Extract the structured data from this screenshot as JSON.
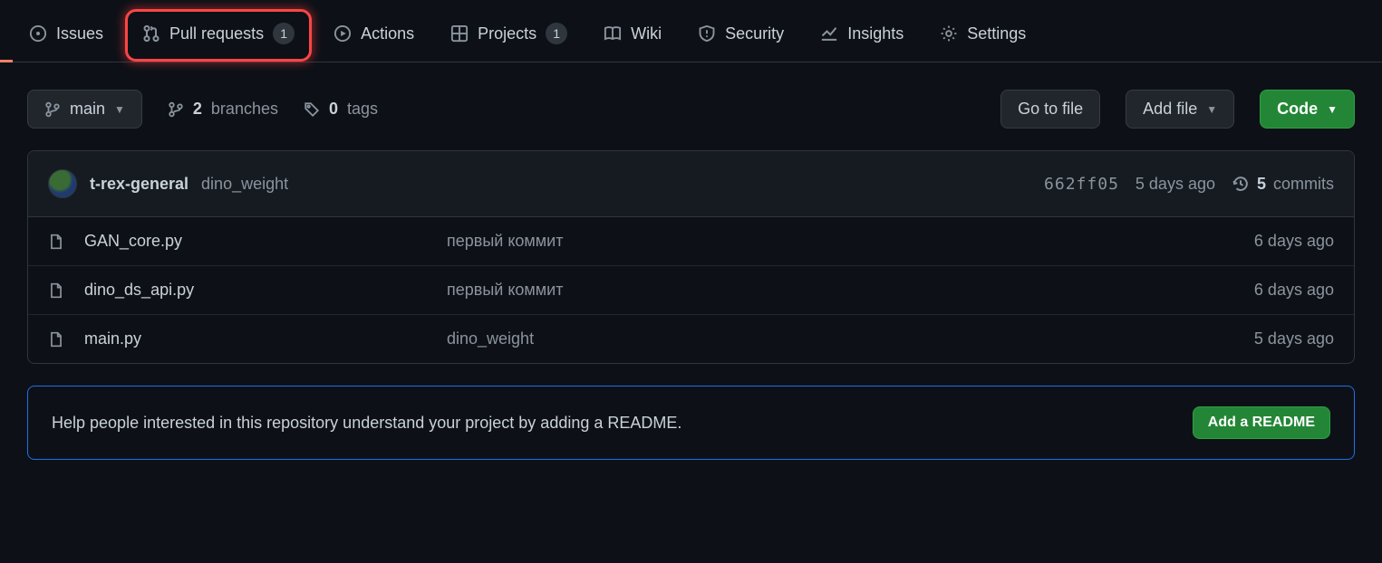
{
  "nav": {
    "issues": "Issues",
    "pull_requests": "Pull requests",
    "pull_requests_count": "1",
    "actions": "Actions",
    "projects": "Projects",
    "projects_count": "1",
    "wiki": "Wiki",
    "security": "Security",
    "insights": "Insights",
    "settings": "Settings"
  },
  "branchbar": {
    "branch_button": "main",
    "branches_count": "2",
    "branches_label": "branches",
    "tags_count": "0",
    "tags_label": "tags",
    "go_to_file": "Go to file",
    "add_file": "Add file",
    "code": "Code"
  },
  "latest_commit": {
    "author": "t-rex-general",
    "message": "dino_weight",
    "sha": "662ff05",
    "time": "5 days ago",
    "commits_count": "5",
    "commits_label": "commits"
  },
  "files": [
    {
      "name": "GAN_core.py",
      "message": "первый коммит",
      "time": "6 days ago"
    },
    {
      "name": "dino_ds_api.py",
      "message": "первый коммит",
      "time": "6 days ago"
    },
    {
      "name": "main.py",
      "message": "dino_weight",
      "time": "5 days ago"
    }
  ],
  "readme_banner": {
    "text": "Help people interested in this repository understand your project by adding a README.",
    "button": "Add a README"
  }
}
